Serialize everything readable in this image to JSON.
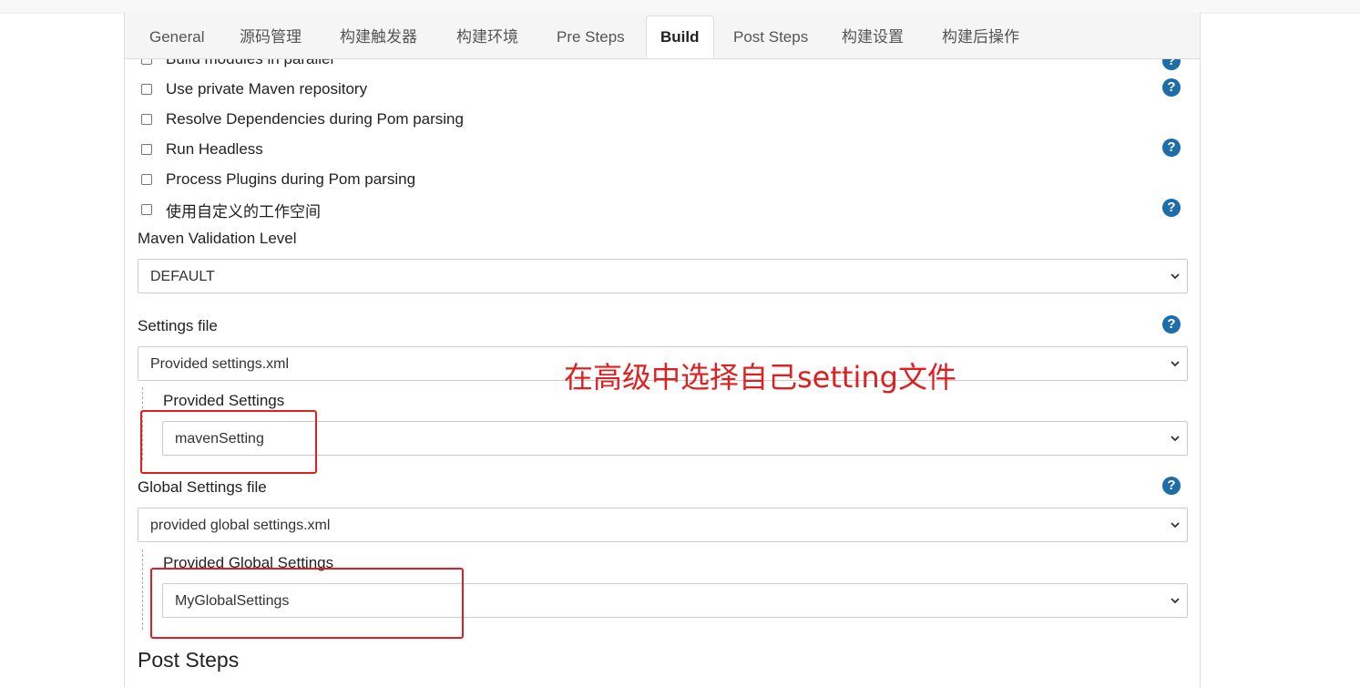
{
  "tabs": [
    {
      "label": "General",
      "active": false
    },
    {
      "label": "源码管理",
      "active": false
    },
    {
      "label": "构建触发器",
      "active": false
    },
    {
      "label": "构建环境",
      "active": false
    },
    {
      "label": "Pre Steps",
      "active": false
    },
    {
      "label": "Build",
      "active": true
    },
    {
      "label": "Post Steps",
      "active": false
    },
    {
      "label": "构建设置",
      "active": false
    },
    {
      "label": "构建后操作",
      "active": false
    }
  ],
  "checkboxes": [
    {
      "label": "Build modules in parallel",
      "checked": false
    },
    {
      "label": "Use private Maven repository",
      "checked": false
    },
    {
      "label": "Resolve Dependencies during Pom parsing",
      "checked": false
    },
    {
      "label": "Run Headless",
      "checked": false
    },
    {
      "label": "Process Plugins during Pom parsing",
      "checked": false
    },
    {
      "label": "使用自定义的工作空间",
      "checked": false
    }
  ],
  "maven_validation": {
    "label": "Maven Validation Level",
    "value": "DEFAULT"
  },
  "settings_file": {
    "label": "Settings file",
    "value": "Provided settings.xml",
    "sub_label": "Provided Settings",
    "sub_value": "mavenSetting"
  },
  "global_settings_file": {
    "label": "Global Settings file",
    "value": "provided global settings.xml",
    "sub_label": "Provided Global Settings",
    "sub_value": "MyGlobalSettings"
  },
  "annotation": "在高级中选择自己setting文件",
  "post_steps_heading": "Post Steps",
  "help_glyph": "?",
  "colors": {
    "help": "#1d6ea8",
    "annotation": "#e02020"
  }
}
